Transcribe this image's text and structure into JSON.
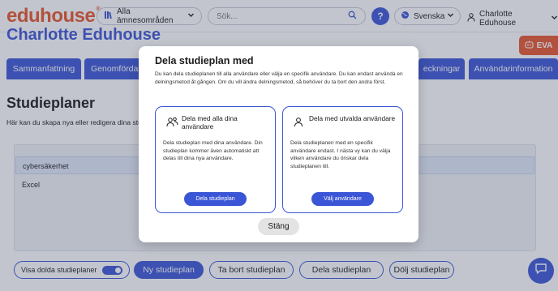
{
  "header": {
    "logo": "eduhouse",
    "logo_mark": "®",
    "subject_areas": "Alla ämnesområden",
    "search_placeholder": "Sök...",
    "help": "?",
    "language": "Svenska",
    "user": "Charlotte Eduhouse"
  },
  "profile": {
    "name": "Charlotte Eduhouse"
  },
  "eva": {
    "label": "EVA"
  },
  "tabs": [
    {
      "label": "Sammanfattning"
    },
    {
      "label": "Genomförda"
    },
    {
      "label": "eckningar"
    },
    {
      "label": "Användarinformation"
    }
  ],
  "page": {
    "title": "Studieplaner",
    "description": "Här kan du skapa nya eller redigera dina stud"
  },
  "plans": {
    "header": "cybersäkerhet",
    "items": [
      {
        "label": "Excel"
      }
    ]
  },
  "bottom": {
    "show_hidden": "Visa dolda studieplaner",
    "new": "Ny studieplan",
    "delete": "Ta bort studieplan",
    "share": "Dela studieplan",
    "hide": "Dölj studieplan"
  },
  "modal": {
    "title": "Dela studieplan med",
    "description": "Du kan dela studieplanen till alla användare eller välja en specifik användare. Du kan endast använda en delningsmetod åt gången. Om du vill ändra delningsmetod, så behöver du ta bort den andra först.",
    "cards": [
      {
        "title": "Dela med alla dina användare",
        "text": "Dela studieplan med dina användare. Din studieplan kommer även automatiskt att delas till dina nya användare.",
        "button": "Dela studieplan"
      },
      {
        "title": "Dela med utvalda användare",
        "text": "Dela studieplanen med en specifik användare endast. I nästa vy kan du välja vilken användare du önskar dela studieplanen till.",
        "button": "Välj användare"
      }
    ],
    "close": "Stäng"
  },
  "colors": {
    "brand_orange": "#e8542b",
    "accent_blue": "#3a55d6"
  },
  "icons": {
    "subject": "grid-book-icon",
    "search": "search-icon",
    "language": "globe-icon",
    "user": "user-icon",
    "chat": "chat-icon",
    "share_all": "users-icon",
    "share_one": "user-icon"
  }
}
